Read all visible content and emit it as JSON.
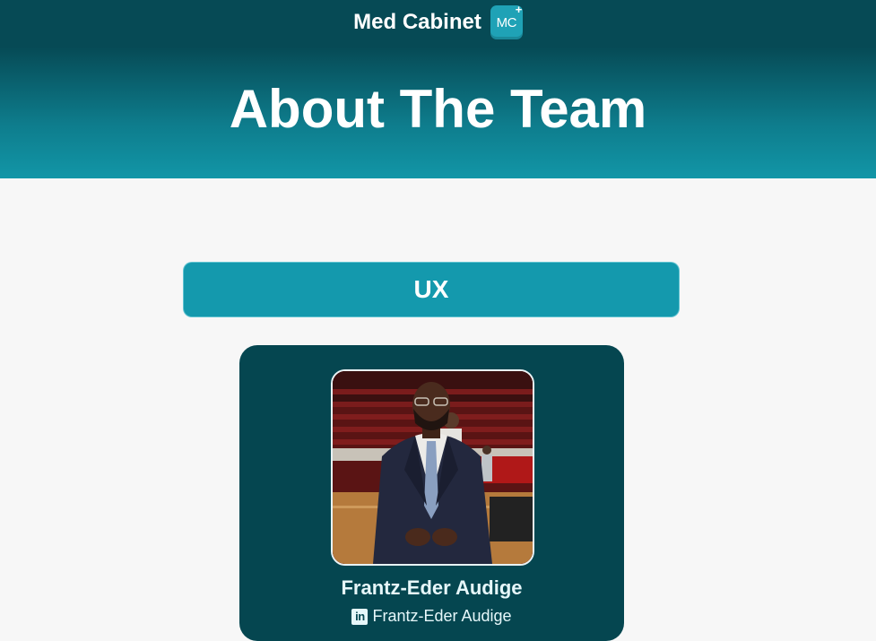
{
  "header": {
    "brand_name": "Med Cabinet",
    "logo_text": "MC",
    "logo_plus": "+",
    "title": "About The Team"
  },
  "sections": [
    {
      "label": "UX",
      "members": [
        {
          "name": "Frantz-Eder Audige",
          "linkedin_label": "Frantz-Eder Audige",
          "linkedin_icon_text": "in",
          "icon": "linkedin-icon"
        }
      ]
    }
  ],
  "colors": {
    "header_dark": "#064a55",
    "header_light": "#1296a7",
    "section_bar": "#1499ad",
    "card_bg": "#054650",
    "page_bg": "#f7f7f7"
  }
}
